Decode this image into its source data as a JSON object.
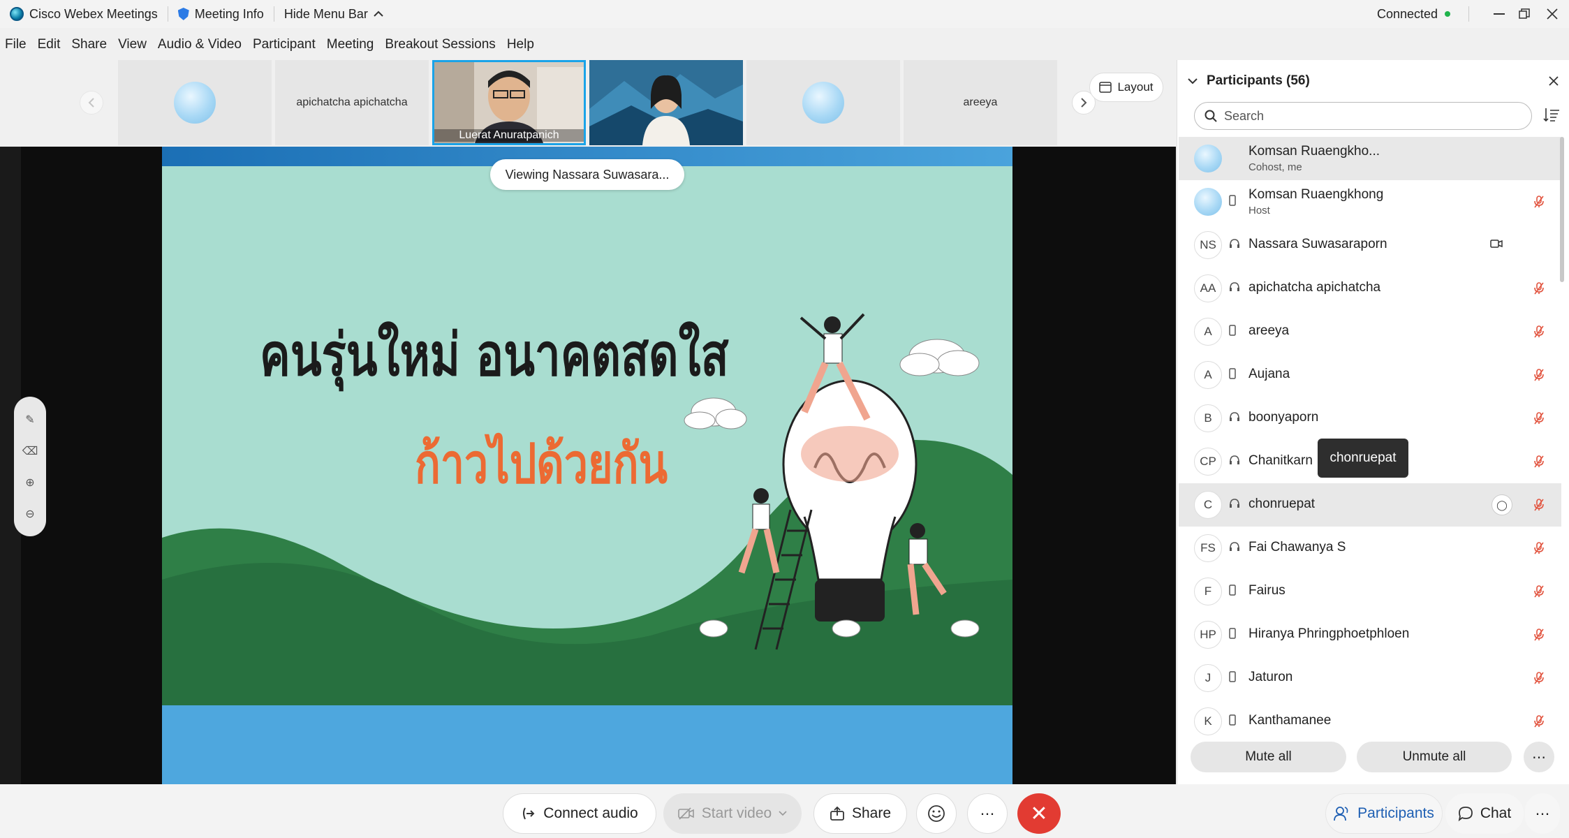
{
  "titlebar": {
    "app_name": "Cisco Webex Meetings",
    "meeting_info": "Meeting Info",
    "hide_menu": "Hide Menu Bar",
    "status": "Connected"
  },
  "menu": [
    "File",
    "Edit",
    "Share",
    "View",
    "Audio & Video",
    "Participant",
    "Meeting",
    "Breakout Sessions",
    "Help"
  ],
  "strip": {
    "thumb2": "apichatcha apichatcha",
    "thumb3": "Luerat Anuratpanich",
    "thumb6": "areeya",
    "layout": "Layout"
  },
  "stage": {
    "viewing": "Viewing Nassara Suwasara...",
    "slide_title": "คนรุ่นใหม่ อนาคตสดใส",
    "slide_subtitle": "ก้าวไปด้วยกัน"
  },
  "panel": {
    "title": "Participants (56)",
    "search_placeholder": "Search",
    "tooltip": "chonruepat",
    "mute_all": "Mute all",
    "unmute_all": "Unmute all",
    "participants": [
      {
        "initials": "",
        "name": "Komsan Ruaengkho...",
        "sub": "Cohost, me"
      },
      {
        "initials": "",
        "name": "Komsan Ruaengkhong",
        "sub": "Host"
      },
      {
        "initials": "NS",
        "name": "Nassara Suwasaraporn",
        "sub": ""
      },
      {
        "initials": "AA",
        "name": "apichatcha apichatcha",
        "sub": ""
      },
      {
        "initials": "A",
        "name": "areeya",
        "sub": ""
      },
      {
        "initials": "A",
        "name": "Aujana",
        "sub": ""
      },
      {
        "initials": "B",
        "name": "boonyaporn",
        "sub": ""
      },
      {
        "initials": "CP",
        "name": "Chanitkarn",
        "sub": ""
      },
      {
        "initials": "C",
        "name": "chonruepat",
        "sub": ""
      },
      {
        "initials": "FS",
        "name": "Fai Chawanya S",
        "sub": ""
      },
      {
        "initials": "F",
        "name": "Fairus",
        "sub": ""
      },
      {
        "initials": "HP",
        "name": "Hiranya Phringphoetphloen",
        "sub": ""
      },
      {
        "initials": "J",
        "name": "Jaturon",
        "sub": ""
      },
      {
        "initials": "K",
        "name": "Kanthamanee",
        "sub": ""
      }
    ]
  },
  "bottombar": {
    "connect_audio": "Connect audio",
    "start_video": "Start video",
    "share": "Share",
    "participants": "Participants",
    "chat": "Chat"
  },
  "colors": {
    "accent": "#1e88e5",
    "end": "#e23b32",
    "muted": "#e2543f"
  }
}
